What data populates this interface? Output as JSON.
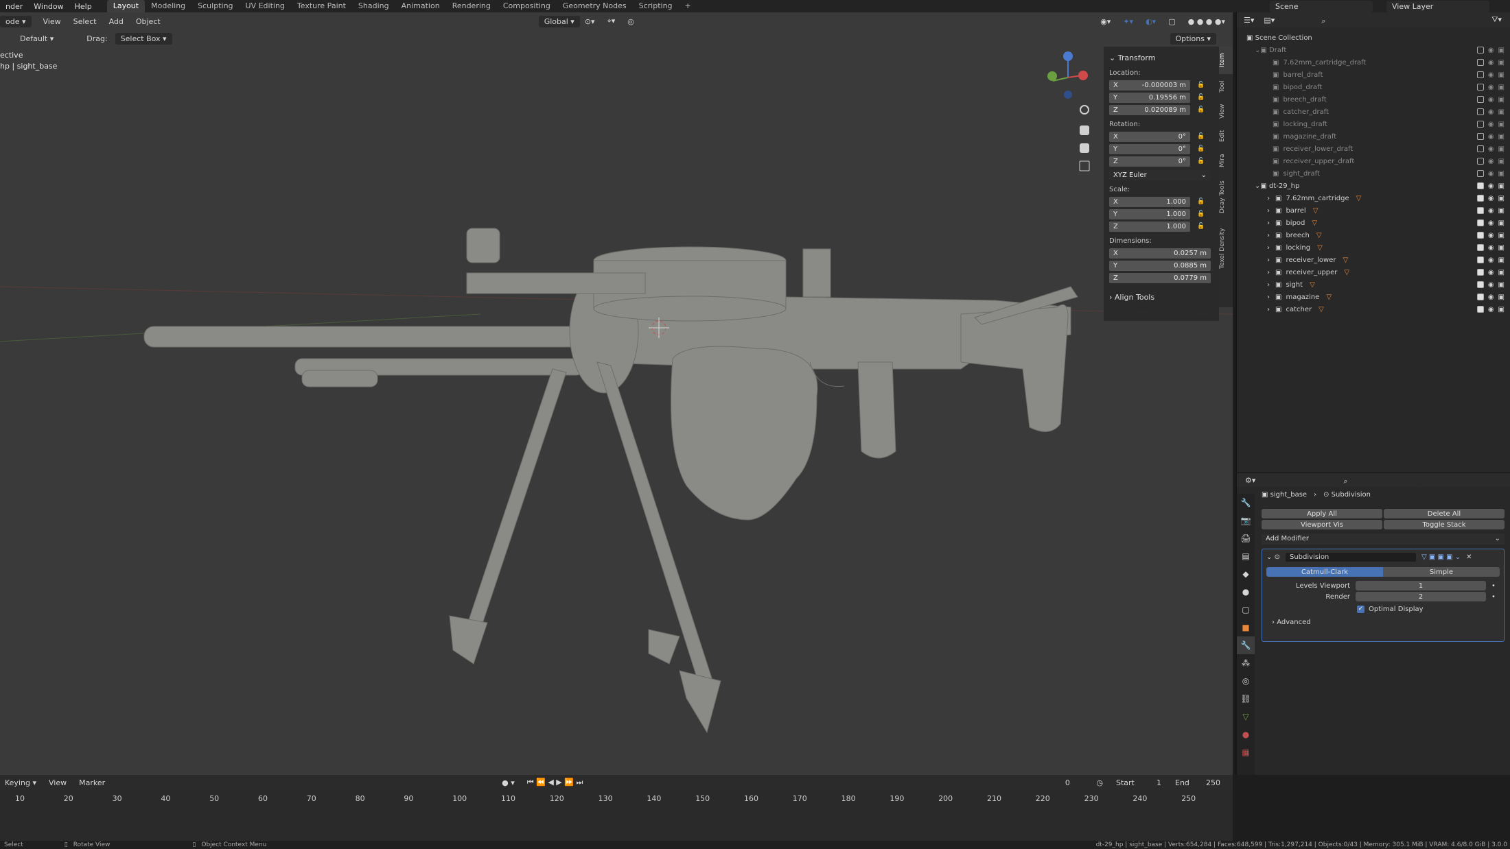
{
  "topbar": {
    "menus": [
      "nder",
      "Window",
      "Help"
    ],
    "workspaces": [
      "Layout",
      "Modeling",
      "Sculpting",
      "UV Editing",
      "Texture Paint",
      "Shading",
      "Animation",
      "Rendering",
      "Compositing",
      "Geometry Nodes",
      "Scripting"
    ],
    "active_workspace": "Layout",
    "scene": "Scene",
    "view_layer": "View Layer"
  },
  "viewport_header": {
    "mode": "ode",
    "menus": [
      "View",
      "Select",
      "Add",
      "Object"
    ],
    "transform_orientation": "Global",
    "options": "Options"
  },
  "viewport_header2": {
    "orientation_label": "Default",
    "drag_label": "Drag:",
    "drag_value": "Select Box"
  },
  "viewport_overlay": {
    "line1": "ective",
    "line2": "hp | sight_base"
  },
  "npanel": {
    "title": "Transform",
    "location_label": "Location:",
    "location": [
      {
        "axis": "X",
        "value": "-0.000003 m"
      },
      {
        "axis": "Y",
        "value": "0.19556 m"
      },
      {
        "axis": "Z",
        "value": "0.020089 m"
      }
    ],
    "rotation_label": "Rotation:",
    "rotation": [
      {
        "axis": "X",
        "value": "0°"
      },
      {
        "axis": "Y",
        "value": "0°"
      },
      {
        "axis": "Z",
        "value": "0°"
      }
    ],
    "rotation_mode": "XYZ Euler",
    "scale_label": "Scale:",
    "scale": [
      {
        "axis": "X",
        "value": "1.000"
      },
      {
        "axis": "Y",
        "value": "1.000"
      },
      {
        "axis": "Z",
        "value": "1.000"
      }
    ],
    "dimensions_label": "Dimensions:",
    "dimensions": [
      {
        "axis": "X",
        "value": "0.0257 m"
      },
      {
        "axis": "Y",
        "value": "0.0885 m"
      },
      {
        "axis": "Z",
        "value": "0.0779 m"
      }
    ],
    "align_tools": "Align Tools",
    "tabs": [
      "Item",
      "Tool",
      "View",
      "Edit",
      "Mira",
      "Dcay Tools",
      "Texel Density"
    ]
  },
  "outliner": {
    "root": "Scene Collection",
    "draft_collection": "Draft",
    "draft_items": [
      "7.62mm_cartridge_draft",
      "barrel_draft",
      "bipod_draft",
      "breech_draft",
      "catcher_draft",
      "locking_draft",
      "magazine_draft",
      "receiver_lower_draft",
      "receiver_upper_draft",
      "sight_draft"
    ],
    "main_collection": "dt-29_hp",
    "main_items": [
      "7.62mm_cartridge",
      "barrel",
      "bipod",
      "breech",
      "locking",
      "receiver_lower",
      "receiver_upper",
      "sight",
      "magazine",
      "catcher"
    ]
  },
  "properties": {
    "breadcrumb_object": "sight_base",
    "breadcrumb_modifier": "Subdivision",
    "apply_all": "Apply All",
    "delete_all": "Delete All",
    "viewport_vis": "Viewport Vis",
    "toggle_stack": "Toggle Stack",
    "add_modifier": "Add Modifier",
    "modifier_name": "Subdivision",
    "catmull_clark": "Catmull-Clark",
    "simple": "Simple",
    "levels_viewport_label": "Levels Viewport",
    "levels_viewport_value": "1",
    "render_label": "Render",
    "render_value": "2",
    "optimal_display": "Optimal Display",
    "advanced": "Advanced"
  },
  "timeline": {
    "keying": "Keying",
    "view": "View",
    "marker": "Marker",
    "current_frame": "0",
    "start_label": "Start",
    "start_value": "1",
    "end_label": "End",
    "end_value": "250",
    "ticks": [
      "10",
      "20",
      "30",
      "40",
      "50",
      "60",
      "70",
      "80",
      "90",
      "100",
      "110",
      "120",
      "130",
      "140",
      "150",
      "160",
      "170",
      "180",
      "190",
      "200",
      "210",
      "220",
      "230",
      "240",
      "250"
    ]
  },
  "statusbar": {
    "select": "Select",
    "rotate_view": "Rotate View",
    "context_menu": "Object Context Menu",
    "stats": "dt-29_hp | sight_base | Verts:654,284 | Faces:648,599 | Tris:1,297,214 | Objects:0/43 | Memory: 305.1 MiB | VRAM: 4.6/8.0 GiB | 3.0.0"
  },
  "colors": {
    "accent_blue": "#4772b3",
    "object_orange": "#e8873a",
    "viewport_bg": "#3a3a3a",
    "model_gray": "#8a8a87"
  }
}
